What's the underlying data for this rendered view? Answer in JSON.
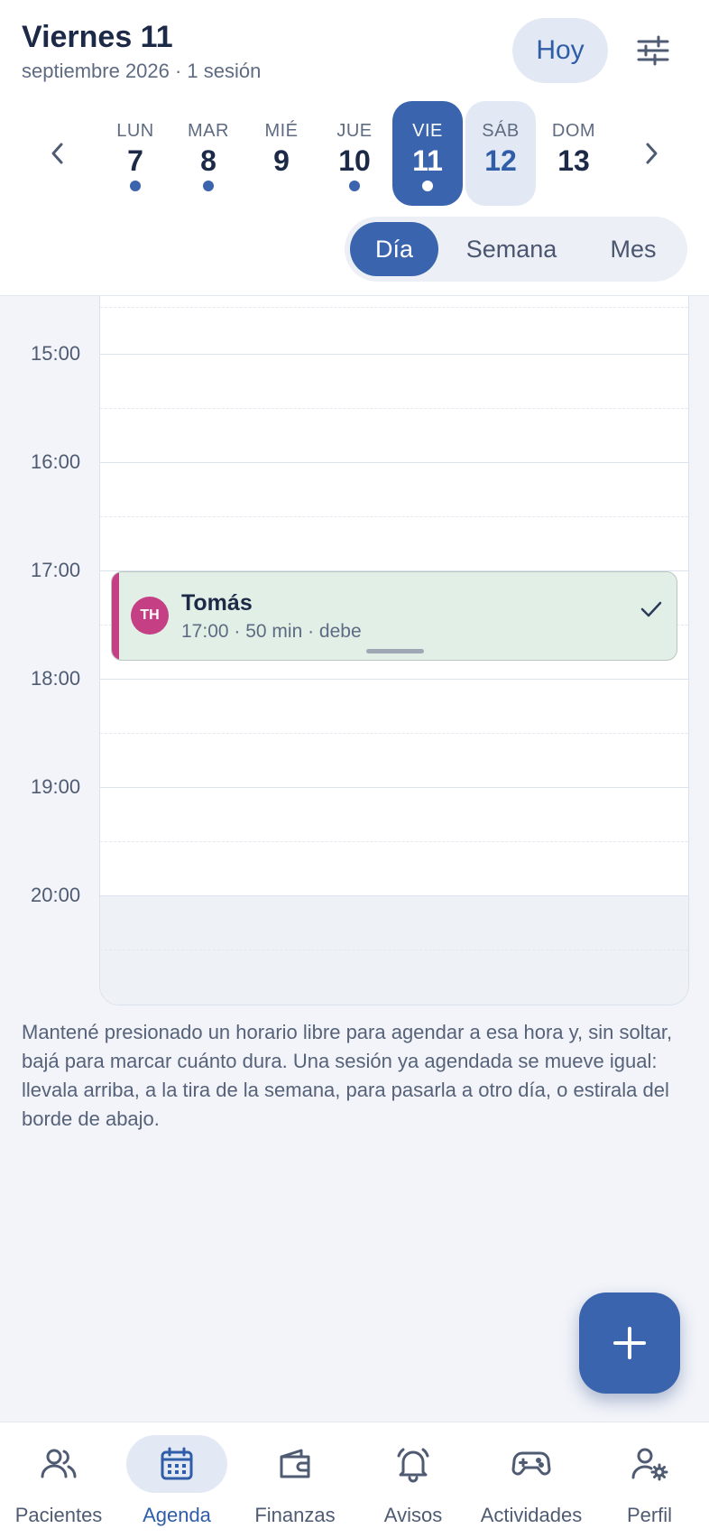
{
  "header": {
    "title": "Viernes 11",
    "subtitle": "septiembre 2026 · 1 sesión",
    "today_label": "Hoy"
  },
  "week": {
    "days": [
      {
        "name": "LUN",
        "num": "7"
      },
      {
        "name": "MAR",
        "num": "8"
      },
      {
        "name": "MIÉ",
        "num": "9"
      },
      {
        "name": "JUE",
        "num": "10"
      },
      {
        "name": "VIE",
        "num": "11"
      },
      {
        "name": "SÁB",
        "num": "12"
      },
      {
        "name": "DOM",
        "num": "13"
      }
    ]
  },
  "view_switch": {
    "day": "Día",
    "week": "Semana",
    "month": "Mes"
  },
  "timeline": {
    "hours": [
      "15:00",
      "16:00",
      "17:00",
      "18:00",
      "19:00",
      "20:00"
    ]
  },
  "event": {
    "initials": "TH",
    "name": "Tomás",
    "meta": "17:00 · 50 min · debe",
    "color": "#c43f84"
  },
  "hint": "Mantené presionado un horario libre para agendar a esa hora y, sin soltar, bajá para marcar cuánto dura. Una sesión ya agendada se mueve igual: llevala arriba, a la tira de la semana, para pasarla a otro día, o estirala del borde de abajo.",
  "tabs": {
    "patients": "Pacientes",
    "agenda": "Agenda",
    "finances": "Finanzas",
    "notices": "Avisos",
    "activities": "Actividades",
    "profile": "Perfil"
  },
  "colors": {
    "accent": "#3a64ad",
    "event_bg": "#e1efe6"
  }
}
